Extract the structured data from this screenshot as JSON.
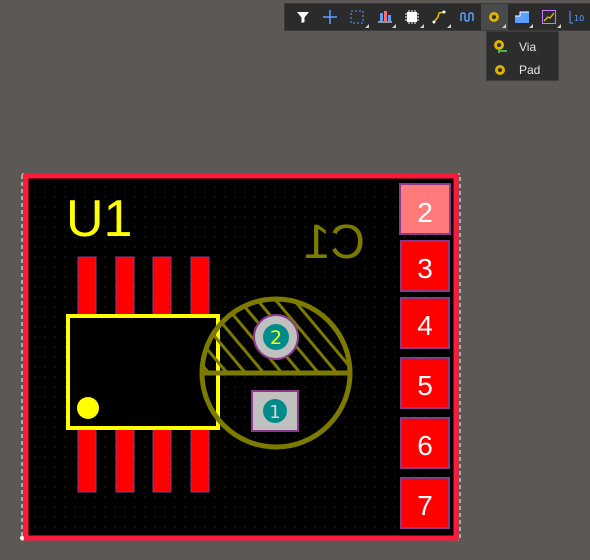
{
  "toolbar": {
    "buttons": [
      {
        "icon": "filter-icon"
      },
      {
        "icon": "crosshair-icon"
      },
      {
        "icon": "select-rect-icon"
      },
      {
        "icon": "align-icon"
      },
      {
        "icon": "component-icon"
      },
      {
        "icon": "route-icon"
      },
      {
        "icon": "interactive-route-icon"
      },
      {
        "icon": "pad-via-icon"
      },
      {
        "icon": "region-icon"
      },
      {
        "icon": "graph-icon"
      },
      {
        "icon": "string-icon"
      }
    ]
  },
  "dropdown": {
    "items": [
      {
        "label": "Via",
        "icon": "via-icon"
      },
      {
        "label": "Pad",
        "icon": "pad-icon"
      }
    ]
  },
  "board": {
    "designators": {
      "u1": "U1",
      "c1": "C1"
    },
    "c1_pads": [
      "2",
      "1"
    ],
    "header_pins": [
      "2",
      "3",
      "4",
      "5",
      "6",
      "7"
    ],
    "colors": {
      "outline": "#ff1a3c",
      "silk": "#ffff00",
      "top_overlay": "#7d7a00",
      "pad": "#ff0000",
      "pad_highlight": "#ff7a7a",
      "mask": "#8b3a8b",
      "via": "#008b8b"
    }
  }
}
